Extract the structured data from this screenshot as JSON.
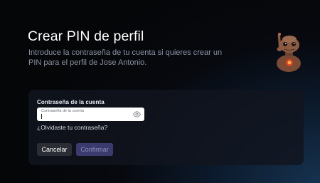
{
  "header": {
    "title": "Crear PIN de perfil",
    "subtitle": "Introduce la contraseña de tu cuenta si quieres crear un PIN para el perfil de Jose Antonio."
  },
  "form": {
    "label": "Contraseña de la cuenta",
    "placeholder": "Contraseña de la cuenta",
    "forgot_link": "¿Olvidaste tu contraseña?"
  },
  "buttons": {
    "cancel": "Cancelar",
    "confirm": "Confirmar"
  },
  "icons": {
    "avatar": "et-avatar-icon",
    "visibility": "eye-icon"
  },
  "colors": {
    "background": "#07090f",
    "card": "#11151e",
    "confirm_button": "#3b3a6e",
    "cancel_button": "#2a2d33"
  }
}
